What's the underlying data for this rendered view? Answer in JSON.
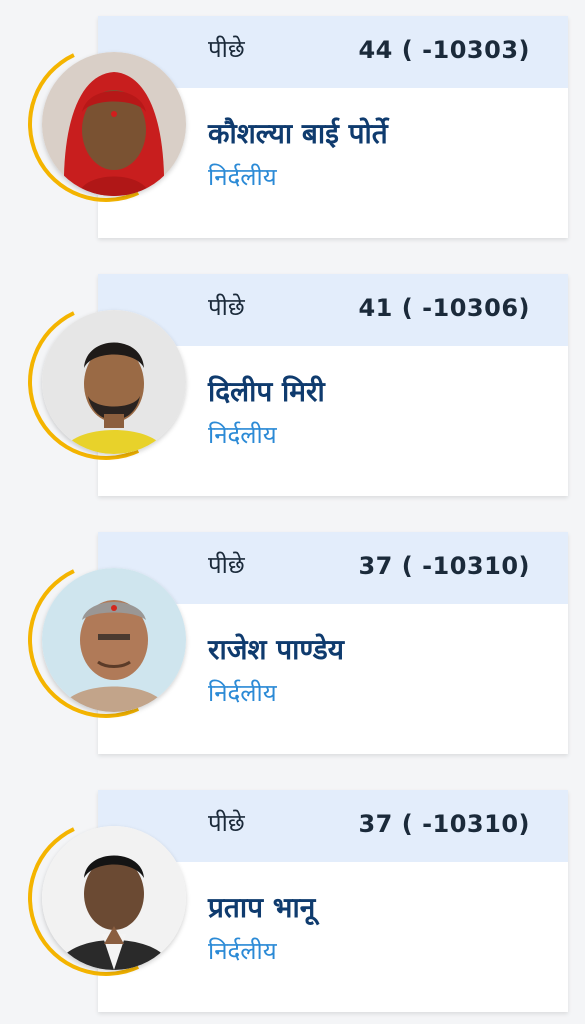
{
  "candidates": [
    {
      "status": "पीछे",
      "votes": "44 ( -10303)",
      "name": "कौशल्या बाई पोर्ते",
      "party": "निर्दलीय",
      "photo_icon": "candidate-photo"
    },
    {
      "status": "पीछे",
      "votes": "41 ( -10306)",
      "name": "दिलीप मिरी",
      "party": "निर्दलीय",
      "photo_icon": "candidate-photo"
    },
    {
      "status": "पीछे",
      "votes": "37 ( -10310)",
      "name": "राजेश पाण्डेय",
      "party": "निर्दलीय",
      "photo_icon": "candidate-photo"
    },
    {
      "status": "पीछे",
      "votes": "37 ( -10310)",
      "name": "प्रताप भानू",
      "party": "निर्दलीय",
      "photo_icon": "candidate-photo"
    }
  ],
  "colors": {
    "header_bg": "#e3edfb",
    "name": "#0f3b6e",
    "party": "#2b8ad6",
    "ring": "#f4b400"
  }
}
